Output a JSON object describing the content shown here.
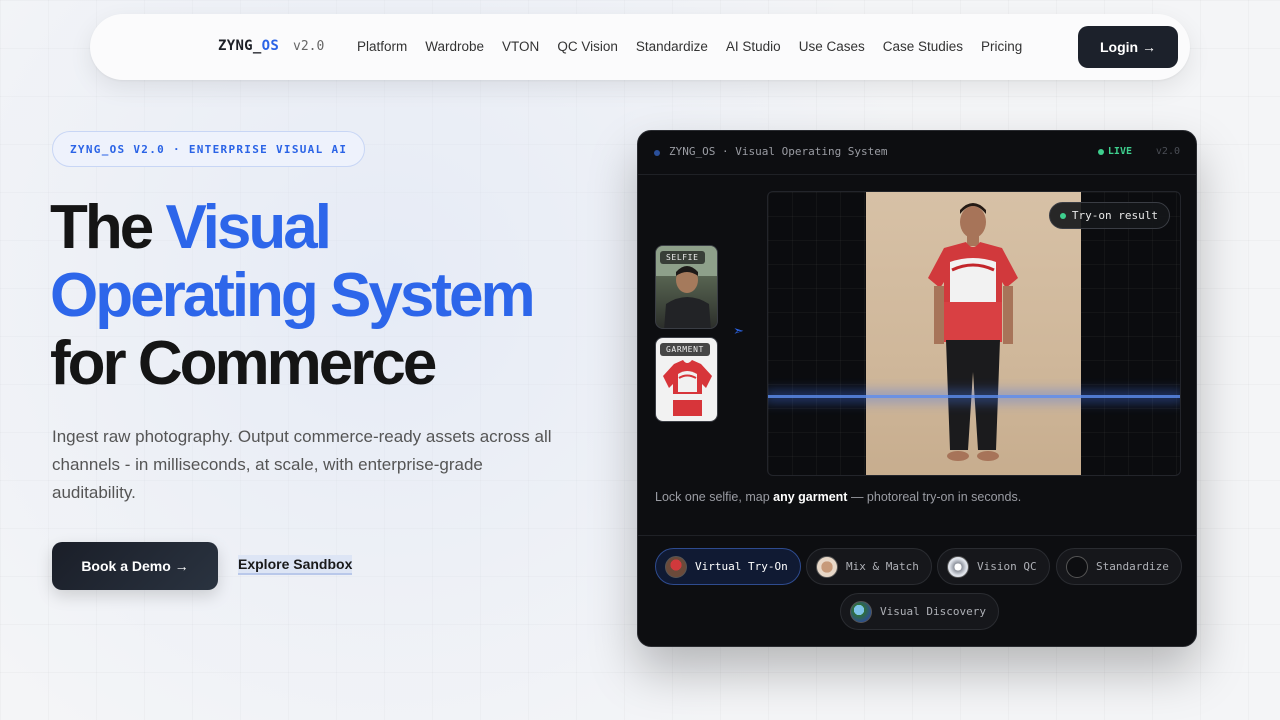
{
  "nav": {
    "brand": "ZYNG_",
    "brand_accent": "OS",
    "version": "v2.0",
    "links": [
      "Platform",
      "Wardrobe",
      "VTON",
      "QC Vision",
      "Standardize",
      "AI Studio",
      "Use Cases",
      "Case Studies",
      "Pricing"
    ],
    "login_label": "Login →"
  },
  "hero": {
    "badge": "ZYNG_OS V2.0 · ENTERPRISE VISUAL AI",
    "headline_line1_a": "The ",
    "headline_line1_b": "Visual",
    "headline_line2": "Operating System",
    "headline_line3": "for Commerce",
    "subtext": "Ingest raw photography. Output commerce-ready assets across all channels - in milliseconds, at scale, with enterprise-grade auditability.",
    "cta_primary": "Book a Demo →",
    "cta_secondary": "Explore Sandbox"
  },
  "panel": {
    "title": "ZYNG_OS · Visual Operating System",
    "status": "LIVE",
    "version": "v2.0",
    "selfie_label": "SELFIE",
    "garment_label": "GARMENT",
    "result_label": "Try-on result",
    "caption_a": "Lock one selfie, map ",
    "caption_b": "any garment",
    "caption_c": " — photoreal try-on in seconds.",
    "tabs": [
      "Virtual Try-On",
      "Mix & Match",
      "Vision QC",
      "Standardize",
      "Visual Discovery"
    ],
    "active_tab": "Virtual Try-On"
  },
  "colors": {
    "accent": "#2d66ea",
    "live": "#3ecf8e",
    "panel_bg": "#0d0e11"
  }
}
